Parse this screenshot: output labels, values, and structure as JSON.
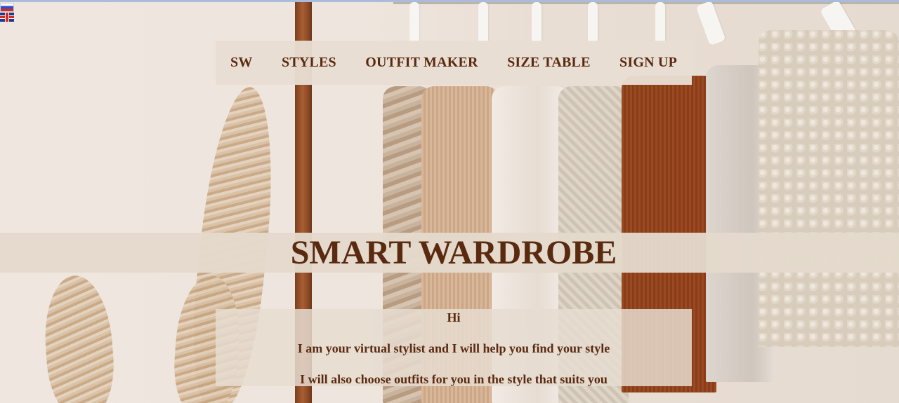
{
  "languages": [
    {
      "name": "russian-flag-icon",
      "colors": [
        "#ffffff",
        "#2b4fd1",
        "#d52b1e"
      ]
    },
    {
      "name": "uk-flag-icon",
      "colors": [
        "#1f3d8f",
        "#ffffff",
        "#d52b1e"
      ]
    }
  ],
  "nav": {
    "items": [
      {
        "label": "SW"
      },
      {
        "label": "STYLES"
      },
      {
        "label": "OUTFIT MAKER"
      },
      {
        "label": "SIZE TABLE"
      },
      {
        "label": "SIGN UP"
      }
    ]
  },
  "hero": {
    "title": "SMART WARDROBE"
  },
  "intro": {
    "greeting": "Hi",
    "line1": "I am your virtual stylist and I will help you find your style",
    "line2": "I will also choose outfits for you in the style that suits you"
  },
  "theme": {
    "text_color": "#5a2a10",
    "panel_color": "#e8ded2"
  }
}
